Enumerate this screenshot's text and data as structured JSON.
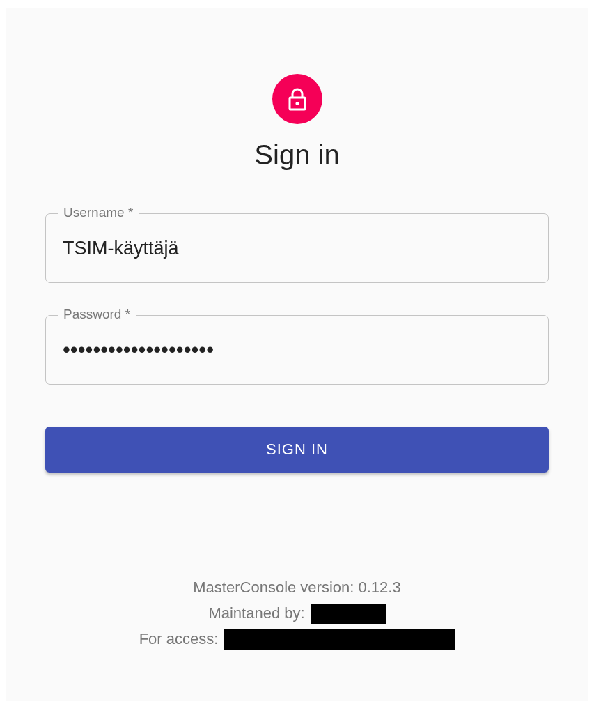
{
  "title": "Sign in",
  "fields": [
    {
      "label": "Username *",
      "value": "TSIM-käyttäjä"
    },
    {
      "label": "Password *",
      "value": "••••••••••••••••••••"
    }
  ],
  "button": "SIGN IN",
  "footer": [
    {
      "text": "MasterConsole version: 0.12.3",
      "redacted": false
    },
    {
      "text": "Maintaned by:",
      "redacted": true
    },
    {
      "text": "For access:",
      "redacted": true
    }
  ]
}
